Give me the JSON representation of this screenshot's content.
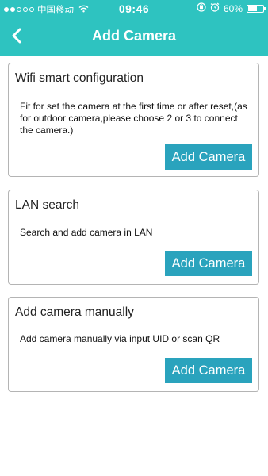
{
  "status_bar": {
    "carrier": "中国移动",
    "time": "09:46",
    "battery_text": "60%",
    "battery_level": 0.6,
    "icons": [
      "signal-dots",
      "wifi-icon",
      "rotation-lock-icon",
      "alarm-icon",
      "battery-icon"
    ]
  },
  "header": {
    "title": "Add Camera",
    "back_icon": "chevron-left-icon",
    "color": "#2ec3c0"
  },
  "options": [
    {
      "title": "Wifi smart configuration",
      "description": "Fit for set the camera at the first time or after reset,(as for outdoor camera,please choose 2 or 3 to connect the camera.)",
      "button_label": "Add Camera"
    },
    {
      "title": "LAN search",
      "description": "Search and add camera in LAN",
      "button_label": "Add Camera"
    },
    {
      "title": "Add camera manually",
      "description": "Add camera manually via input UID or scan QR",
      "button_label": "Add Camera"
    }
  ],
  "colors": {
    "accent": "#2ec3c0",
    "button": "#2aa3bd",
    "card_border": "#b4b4b4"
  }
}
